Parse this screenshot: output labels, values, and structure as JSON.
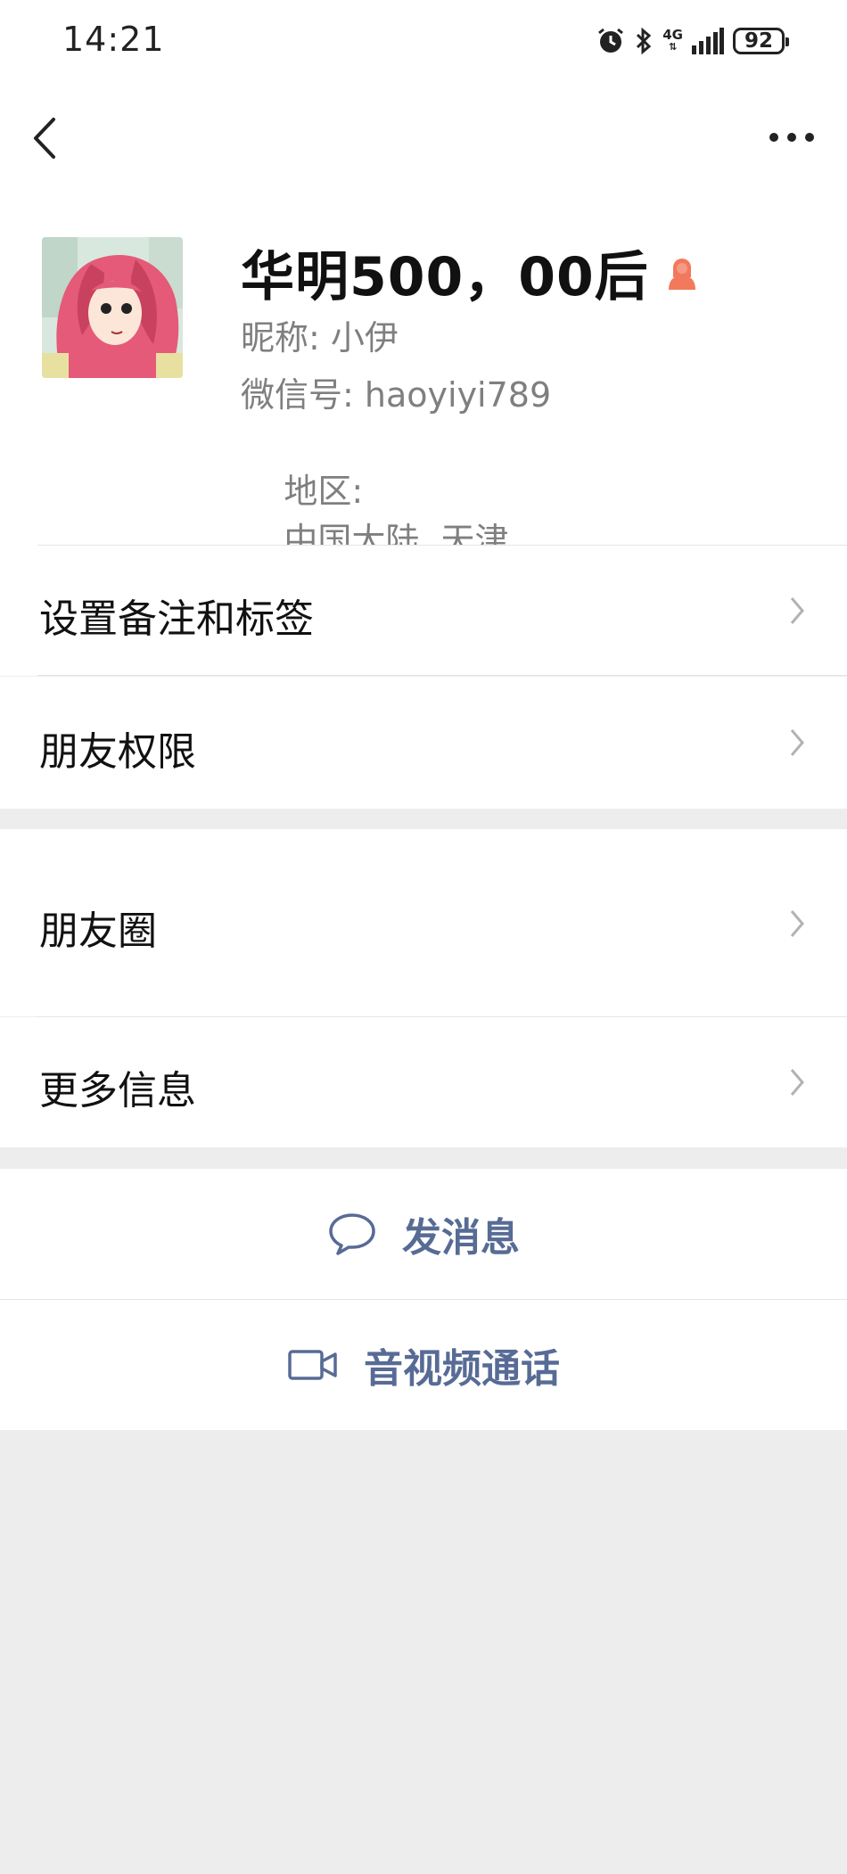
{
  "status_bar": {
    "time": "14:21",
    "network": "4G",
    "battery": "92",
    "icons": [
      "alarm-icon",
      "bluetooth-icon",
      "signal-icon",
      "battery-icon"
    ]
  },
  "nav": {
    "back_icon": "chevron-left-icon",
    "more_icon": "more-dots-icon"
  },
  "profile": {
    "name": "华明500，00后",
    "gender_icon": "female-icon",
    "gender_color": "#f3795c",
    "nickname_label": "昵称:",
    "nickname": "小伊",
    "wechat_label": "微信号:",
    "wechat_id": "haoyiyi789",
    "region_label": "地区:",
    "region": "中国大陆  天津"
  },
  "menu_group_1": [
    {
      "label": "设置备注和标签"
    },
    {
      "label": "朋友权限"
    }
  ],
  "menu_group_2": [
    {
      "label": "朋友圈"
    },
    {
      "label": "更多信息"
    }
  ],
  "actions": {
    "message_label": "发消息",
    "call_label": "音视频通话",
    "accent_color": "#576b95"
  }
}
